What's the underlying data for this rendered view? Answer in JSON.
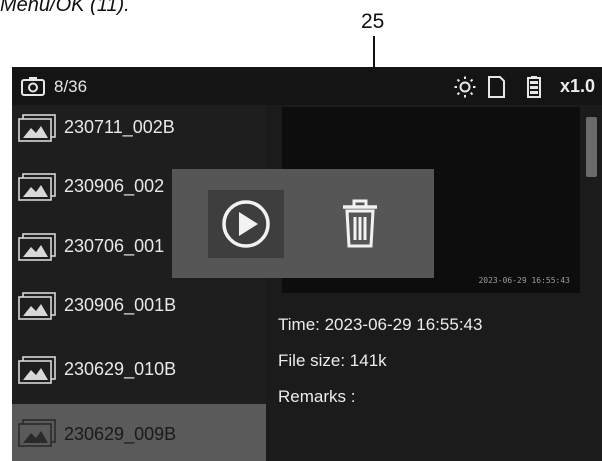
{
  "document": {
    "caption_fragment": "Menu/OK (11).",
    "callout_number": "25"
  },
  "status_bar": {
    "file_count": "8/36",
    "icons": [
      "camera-icon",
      "brightness-icon",
      "sd-card-icon",
      "battery-icon"
    ],
    "zoom": "x1.0"
  },
  "file_list": {
    "items": [
      {
        "name": "230711_002B",
        "selected": false
      },
      {
        "name": "230906_002",
        "selected": false
      },
      {
        "name": "230706_001",
        "selected": false
      },
      {
        "name": "230906_001B",
        "selected": false
      },
      {
        "name": "230629_010B",
        "selected": false
      },
      {
        "name": "230629_009B",
        "selected": true
      }
    ]
  },
  "preview": {
    "timestamp": "2023-06-29 16:55:43"
  },
  "info": {
    "time": "Time: 2023-06-29  16:55:43",
    "file_size": "File size: 141k",
    "remarks": "Remarks :"
  },
  "popup": {
    "actions": [
      "play-icon",
      "trash-icon"
    ]
  },
  "colors": {
    "screen_bg": "#1b1b1b",
    "selected_row": "#5a5a5a",
    "popup_bg": "#565656"
  }
}
